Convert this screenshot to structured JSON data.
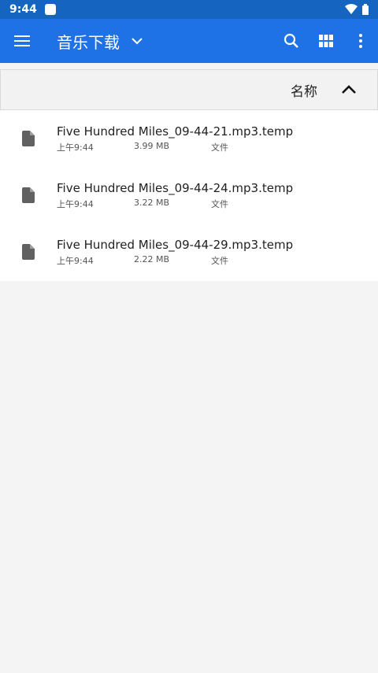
{
  "status": {
    "time": "9:44"
  },
  "app_bar": {
    "title": "音乐下载"
  },
  "sort": {
    "label": "名称"
  },
  "files": [
    {
      "name": "Five Hundred Miles_09-44-21.mp3.temp",
      "time": "上午9:44",
      "size": "3.99 MB",
      "type": "文件"
    },
    {
      "name": "Five Hundred Miles_09-44-24.mp3.temp",
      "time": "上午9:44",
      "size": "3.22 MB",
      "type": "文件"
    },
    {
      "name": "Five Hundred Miles_09-44-29.mp3.temp",
      "time": "上午9:44",
      "size": "2.22 MB",
      "type": "文件"
    }
  ],
  "icons": {
    "menu": "menu-icon",
    "dropdown": "chevron-down-icon",
    "search": "search-icon",
    "grid": "grid-view-icon",
    "more": "more-vert-icon",
    "sort": "chevron-up-icon",
    "file": "file-icon"
  },
  "colors": {
    "status_bar": "#1565c0",
    "app_bar": "#1e72e6",
    "background": "#f4f4f4"
  }
}
